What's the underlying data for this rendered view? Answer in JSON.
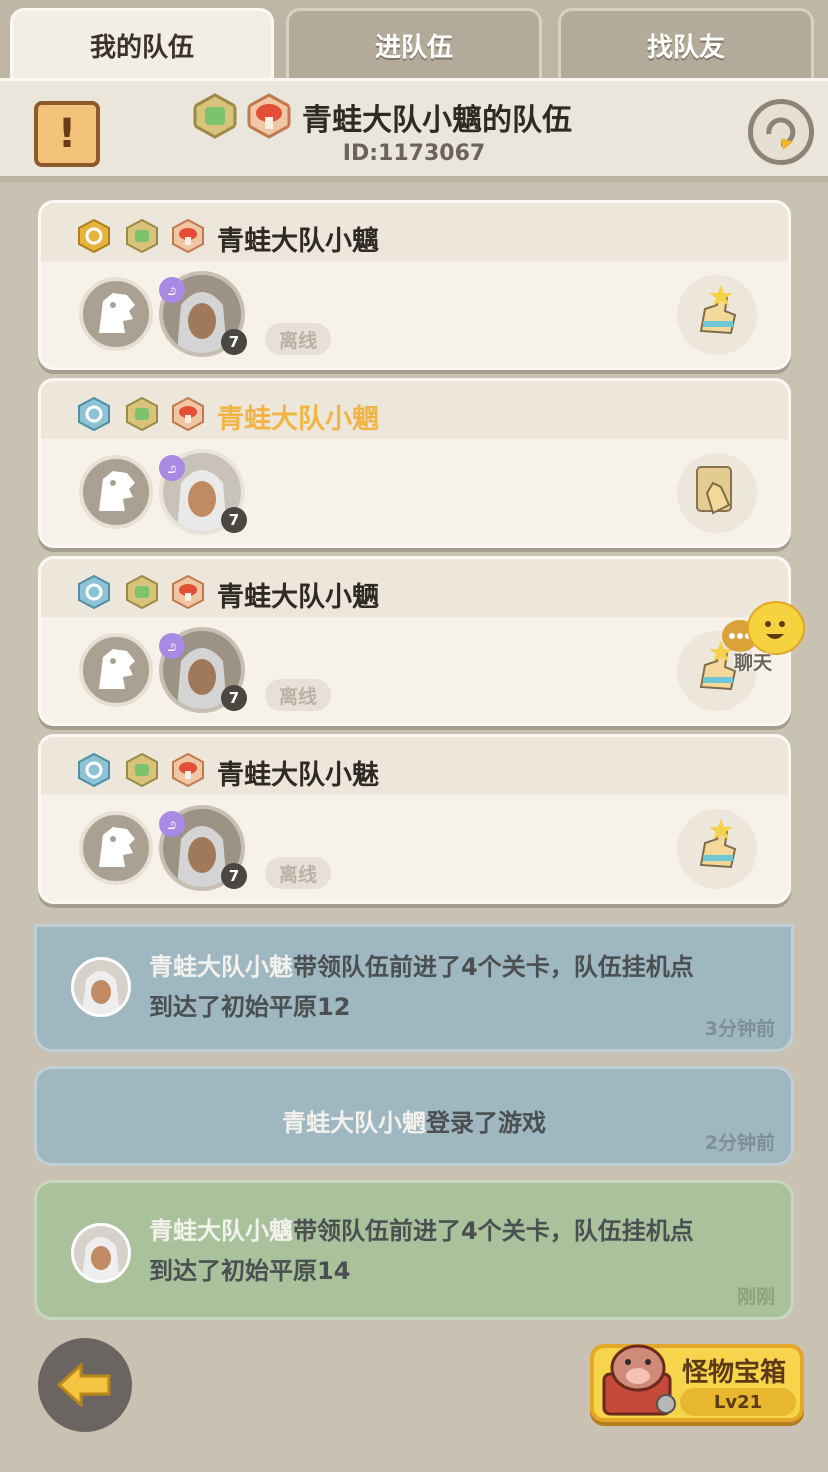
{
  "tabs": [
    {
      "label": "我的队伍",
      "active": true
    },
    {
      "label": "进队伍",
      "active": false
    },
    {
      "label": "找队友",
      "active": false
    }
  ],
  "header": {
    "team_name": "青蛙大队小魑的队伍",
    "team_id": "ID:1173067"
  },
  "members": [
    {
      "name": "青蛙大队小魑",
      "status": "离线",
      "level": "7",
      "highlight": false,
      "shield_color": "#e4b43c"
    },
    {
      "name": "青蛙大队小魍",
      "status": "",
      "level": "7",
      "highlight": true,
      "shield_color": "#8ec3d6"
    },
    {
      "name": "青蛙大队小魉",
      "status": "离线",
      "level": "7",
      "highlight": false,
      "shield_color": "#8ec3d6"
    },
    {
      "name": "青蛙大队小魅",
      "status": "离线",
      "level": "7",
      "highlight": false,
      "shield_color": "#8ec3d6"
    }
  ],
  "chat": {
    "label": "聊天"
  },
  "log": [
    {
      "name": "青蛙大队小魅",
      "text_line1": "带领队伍前进了4个关卡，队伍挂机点",
      "text_line2": "到达了初始平原12",
      "time": "3分钟前",
      "color": "blue"
    },
    {
      "name": "青蛙大队小魍",
      "text": "登录了游戏",
      "time": "2分钟前",
      "color": "blue"
    },
    {
      "name": "青蛙大队小魑",
      "text_line1": "带领队伍前进了4个关卡，队伍挂机点",
      "text_line2": "到达了初始平原14",
      "time": "刚刚",
      "color": "green"
    }
  ],
  "chest": {
    "title": "怪物宝箱",
    "level": "Lv21"
  }
}
